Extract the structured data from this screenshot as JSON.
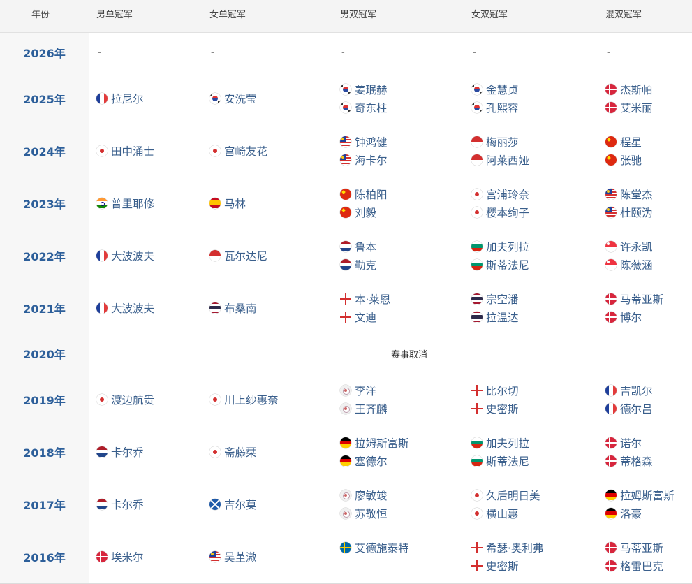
{
  "headers": [
    "年份",
    "男单冠军",
    "女单冠军",
    "男双冠军",
    "女双冠军",
    "混双冠军"
  ],
  "cancel_text": "赛事取消",
  "dash": "-",
  "rows": [
    {
      "year": "2026年",
      "empty": true
    },
    {
      "year": "2025年",
      "ms": [
        {
          "flag": "FRA",
          "name": "拉尼尔"
        }
      ],
      "ws": [
        {
          "flag": "KOR",
          "name": "安洗莹"
        }
      ],
      "md": [
        {
          "flag": "KOR",
          "name": "姜珉赫"
        },
        {
          "flag": "KOR",
          "name": "奇东柱"
        }
      ],
      "wd": [
        {
          "flag": "KOR",
          "name": "金慧贞"
        },
        {
          "flag": "KOR",
          "name": "孔熙容"
        }
      ],
      "xd": [
        {
          "flag": "DEN",
          "name": "杰斯帕"
        },
        {
          "flag": "DEN",
          "name": "艾米丽"
        }
      ]
    },
    {
      "year": "2024年",
      "ms": [
        {
          "flag": "JPN",
          "name": "田中涌士"
        }
      ],
      "ws": [
        {
          "flag": "JPN",
          "name": "宫崎友花"
        }
      ],
      "md": [
        {
          "flag": "MAS",
          "name": "钟鸿健"
        },
        {
          "flag": "MAS",
          "name": "海卡尔"
        }
      ],
      "wd": [
        {
          "flag": "INA",
          "name": "梅丽莎"
        },
        {
          "flag": "INA",
          "name": "阿莱西娅"
        }
      ],
      "xd": [
        {
          "flag": "CHN",
          "name": "程星"
        },
        {
          "flag": "CHN",
          "name": "张驰"
        }
      ]
    },
    {
      "year": "2023年",
      "ms": [
        {
          "flag": "IND",
          "name": "普里耶修"
        }
      ],
      "ws": [
        {
          "flag": "ESP",
          "name": "马林"
        }
      ],
      "md": [
        {
          "flag": "CHN",
          "name": "陈柏阳"
        },
        {
          "flag": "CHN",
          "name": "刘毅"
        }
      ],
      "wd": [
        {
          "flag": "JPN",
          "name": "宫浦玲奈"
        },
        {
          "flag": "JPN",
          "name": "樱本绚子"
        }
      ],
      "xd": [
        {
          "flag": "MAS",
          "name": "陈堂杰"
        },
        {
          "flag": "MAS",
          "name": "杜颐沩"
        }
      ]
    },
    {
      "year": "2022年",
      "ms": [
        {
          "flag": "FRA",
          "name": "大波波夫"
        }
      ],
      "ws": [
        {
          "flag": "INA",
          "name": "瓦尔达尼"
        }
      ],
      "md": [
        {
          "flag": "NED",
          "name": "鲁本"
        },
        {
          "flag": "NED",
          "name": "勒克"
        }
      ],
      "wd": [
        {
          "flag": "BUL",
          "name": "加夫列拉"
        },
        {
          "flag": "BUL",
          "name": "斯蒂法尼"
        }
      ],
      "xd": [
        {
          "flag": "SGP",
          "name": "许永凯"
        },
        {
          "flag": "SGP",
          "name": "陈薇涵"
        }
      ]
    },
    {
      "year": "2021年",
      "ms": [
        {
          "flag": "FRA",
          "name": "大波波夫"
        }
      ],
      "ws": [
        {
          "flag": "THA",
          "name": "布桑南"
        }
      ],
      "md": [
        {
          "flag": "ENG",
          "name": "本·莱恩"
        },
        {
          "flag": "ENG",
          "name": "文迪"
        }
      ],
      "wd": [
        {
          "flag": "THA",
          "name": "宗空潘"
        },
        {
          "flag": "THA",
          "name": "拉温达"
        }
      ],
      "xd": [
        {
          "flag": "DEN",
          "name": "马蒂亚斯"
        },
        {
          "flag": "DEN",
          "name": "博尔"
        }
      ]
    },
    {
      "year": "2020年",
      "cancelled": true
    },
    {
      "year": "2019年",
      "ms": [
        {
          "flag": "JPN",
          "name": "渡边航贵"
        }
      ],
      "ws": [
        {
          "flag": "JPN",
          "name": "川上纱惠奈"
        }
      ],
      "md": [
        {
          "flag": "TPE",
          "name": "李洋"
        },
        {
          "flag": "TPE",
          "name": "王齐麟"
        }
      ],
      "wd": [
        {
          "flag": "ENG",
          "name": "比尔切"
        },
        {
          "flag": "ENG",
          "name": "史密斯"
        }
      ],
      "xd": [
        {
          "flag": "FRA",
          "name": "吉凯尔"
        },
        {
          "flag": "FRA",
          "name": "德尔吕"
        }
      ]
    },
    {
      "year": "2018年",
      "ms": [
        {
          "flag": "NED",
          "name": "卡尔乔"
        }
      ],
      "ws": [
        {
          "flag": "JPN",
          "name": "斋藤栞"
        }
      ],
      "md": [
        {
          "flag": "GER",
          "name": "拉姆斯富斯"
        },
        {
          "flag": "GER",
          "name": "塞德尔"
        }
      ],
      "wd": [
        {
          "flag": "BUL",
          "name": "加夫列拉"
        },
        {
          "flag": "BUL",
          "name": "斯蒂法尼"
        }
      ],
      "xd": [
        {
          "flag": "DEN",
          "name": "诺尔"
        },
        {
          "flag": "DEN",
          "name": "蒂格森"
        }
      ]
    },
    {
      "year": "2017年",
      "ms": [
        {
          "flag": "NED",
          "name": "卡尔乔"
        }
      ],
      "ws": [
        {
          "flag": "SCO",
          "name": "吉尔莫"
        }
      ],
      "md": [
        {
          "flag": "TPE",
          "name": "廖敏竣"
        },
        {
          "flag": "TPE",
          "name": "苏敬恒"
        }
      ],
      "wd": [
        {
          "flag": "JPN",
          "name": "久后明日美"
        },
        {
          "flag": "JPN",
          "name": "横山惠"
        }
      ],
      "xd": [
        {
          "flag": "GER",
          "name": "拉姆斯富斯"
        },
        {
          "flag": "GER",
          "name": "洛豪"
        }
      ]
    },
    {
      "year": "2016年",
      "ms": [
        {
          "flag": "DEN",
          "name": "埃米尔"
        }
      ],
      "ws": [
        {
          "flag": "MAS",
          "name": "吴堇溦"
        }
      ],
      "md": [
        {
          "flag": "SWE",
          "name": "艾德施泰特"
        }
      ],
      "wd": [
        {
          "flag": "ENG",
          "name": "希瑟·奥利弗"
        },
        {
          "flag": "ENG",
          "name": "史密斯"
        }
      ],
      "xd": [
        {
          "flag": "DEN",
          "name": "马蒂亚斯"
        },
        {
          "flag": "DEN",
          "name": "格雷巴克"
        }
      ]
    }
  ],
  "colors": {
    "year": "#2d5f9a",
    "name": "#3a5f8c",
    "header_bg": "#f4f4f4"
  }
}
